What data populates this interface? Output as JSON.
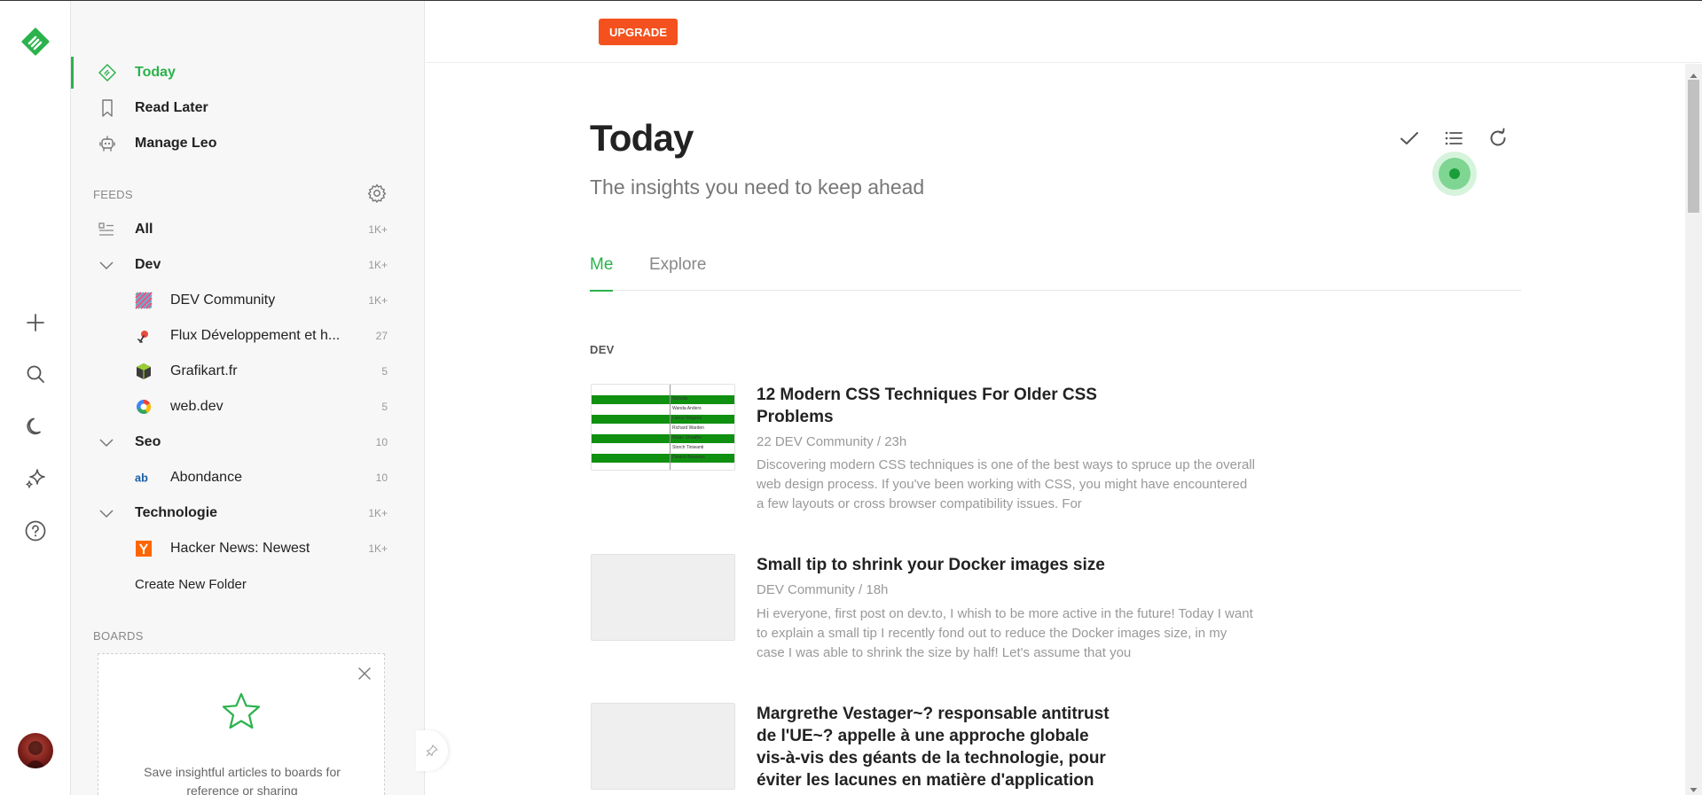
{
  "colors": {
    "accent": "#2bb24c",
    "upgrade": "#f4511e"
  },
  "rail": {
    "logo_icon": "feedly-logo-icon",
    "icons": [
      "add-icon",
      "search-icon",
      "moon-icon",
      "sparkle-icon",
      "help-icon"
    ]
  },
  "sidebar": {
    "nav": [
      {
        "label": "Today",
        "icon": "today-icon"
      },
      {
        "label": "Read Later",
        "icon": "bookmark-icon"
      },
      {
        "label": "Manage Leo",
        "icon": "leo-robot-icon"
      }
    ],
    "feeds_label": "FEEDS",
    "feeds": {
      "all": {
        "label": "All",
        "count": "1K+"
      },
      "folders": [
        {
          "name": "Dev",
          "count": "1K+",
          "items": [
            {
              "name": "DEV Community",
              "count": "1K+",
              "icon": "dev-community-icon"
            },
            {
              "name": "Flux Développement et h...",
              "count": "27",
              "icon": "flux-dev-icon"
            },
            {
              "name": "Grafikart.fr",
              "count": "5",
              "icon": "grafikart-icon"
            },
            {
              "name": "web.dev",
              "count": "5",
              "icon": "webdev-icon"
            }
          ]
        },
        {
          "name": "Seo",
          "count": "10",
          "items": [
            {
              "name": "Abondance",
              "count": "10",
              "icon": "abondance-icon"
            }
          ]
        },
        {
          "name": "Technologie",
          "count": "1K+",
          "items": [
            {
              "name": "Hacker News: Newest",
              "count": "1K+",
              "icon": "hacker-news-icon"
            }
          ]
        }
      ],
      "create_folder": "Create New Folder"
    },
    "boards_label": "BOARDS",
    "board_card": {
      "text": "Save insightful articles to boards for reference or sharing"
    }
  },
  "topbar": {
    "upgrade_label": "UPGRADE"
  },
  "main": {
    "title": "Today",
    "subtitle": "The insights you need to keep ahead",
    "tabs": [
      {
        "label": "Me"
      },
      {
        "label": "Explore"
      }
    ],
    "section_label": "DEV",
    "articles": [
      {
        "title": "12 Modern CSS Techniques For Older CSS Problems",
        "meta": "22  DEV Community / 23h",
        "excerpt": "Discovering modern CSS techniques is one of the best ways to spruce up the overall web design process. If you've been working with CSS, you might have encountered a few layouts or cross browser compatibility issues. For",
        "thumb_rows": [
          "Nichelle",
          "Wanda Anders",
          "Lance Shigeno",
          "Richard Warden",
          "Nolan Sheaffer",
          "Storch Tiniwanti",
          "Destrid Bowman"
        ]
      },
      {
        "title": "Small tip to shrink your Docker images size",
        "meta": "DEV Community / 18h",
        "excerpt": "Hi everyone, first post on dev.to, I whish to be more active in the future! Today I want to explain a small tip I recently fond out to reduce the Docker images size, in my case I was able to shrink the size by half! Let's assume that you"
      },
      {
        "title": "Margrethe Vestager~? responsable antitrust de l'UE~? appelle à une approche globale vis-à-vis des géants de la technologie, pour éviter les lacunes en matière d'application"
      }
    ]
  }
}
